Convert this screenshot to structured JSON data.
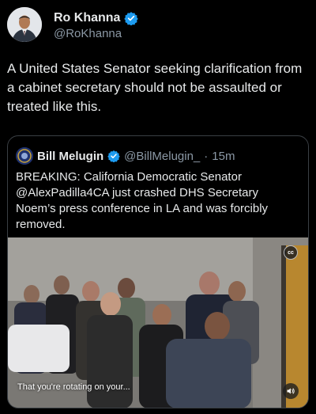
{
  "author": {
    "display_name": "Ro Khanna",
    "handle": "@RoKhanna",
    "verified": true,
    "avatar_icon": "profile-photo"
  },
  "tweet": {
    "text": "A United States Senator seeking clarification from a cabinet secretary should not be assaulted or treated like this."
  },
  "quoted": {
    "display_name": "Bill Melugin",
    "handle": "@BillMelugin_",
    "separator": "·",
    "time": "15m",
    "verified": true,
    "text": "BREAKING: California Democratic Senator @AlexPadilla4CA just crashed DHS Secretary Noem’s press conference in LA and was forcibly removed.",
    "video": {
      "caption": "That you're rotating on your...",
      "cc_label": "cc",
      "cc_icon": "closed-captions-icon",
      "volume_icon": "volume-icon"
    }
  },
  "colors": {
    "background": "#000000",
    "text_primary": "#e7e9ea",
    "text_secondary": "#8b98a5",
    "verified_badge": "#1d9bf0",
    "card_border": "#3a3f44"
  }
}
